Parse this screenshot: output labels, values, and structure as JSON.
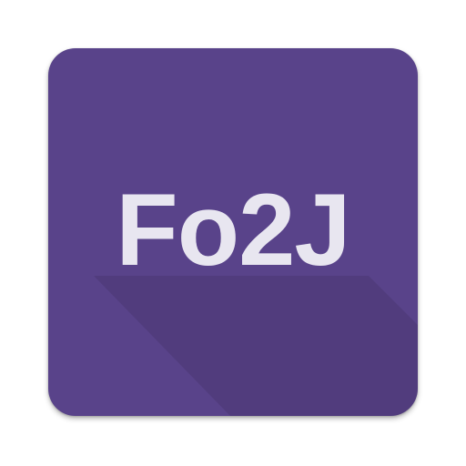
{
  "app_icon": {
    "text": "Fo2J",
    "tile_color": "#59438a",
    "text_color": "#e8e6f0"
  }
}
